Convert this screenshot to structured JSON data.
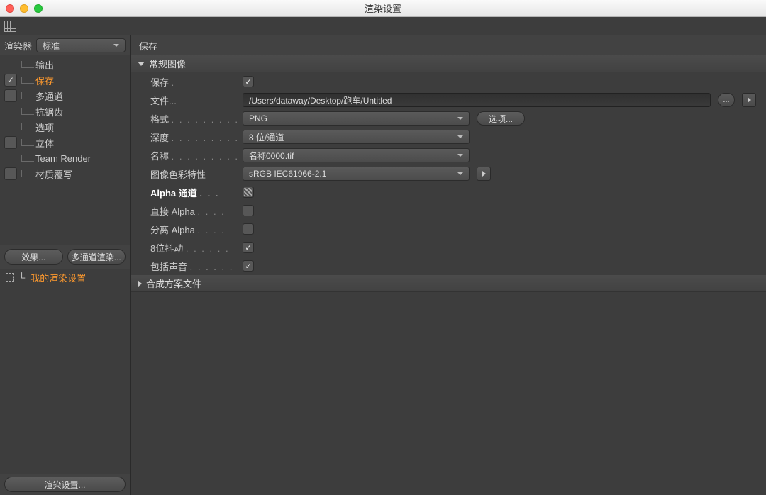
{
  "window": {
    "title": "渲染设置"
  },
  "renderer": {
    "label": "渲染器",
    "value": "标准"
  },
  "sidebar": {
    "items": [
      {
        "label": "输出",
        "check": "none"
      },
      {
        "label": "保存",
        "check": "on",
        "active": true
      },
      {
        "label": "多通道",
        "check": "off"
      },
      {
        "label": "抗锯齿",
        "check": "none"
      },
      {
        "label": "选项",
        "check": "none"
      },
      {
        "label": "立体",
        "check": "off"
      },
      {
        "label": "Team Render",
        "check": "none"
      },
      {
        "label": "材质覆写",
        "check": "off"
      }
    ],
    "effect_btn": "效果...",
    "multipass_btn": "多通道渲染...",
    "my_settings": "我的渲染设置"
  },
  "footer": {
    "button": "渲染设置..."
  },
  "content": {
    "title": "保存",
    "section_regular": "常规图像",
    "section_composite": "合成方案文件",
    "rows": {
      "save": {
        "label": "保存",
        "dots": "."
      },
      "file": {
        "label": "文件...",
        "value": "/Users/dataway/Desktop/跑车/Untitled",
        "browse": "..."
      },
      "format": {
        "label": "格式",
        "dots": ". . . . . . . . .",
        "value": "PNG",
        "options_btn": "选项..."
      },
      "depth": {
        "label": "深度",
        "dots": ". . . . . . . . .",
        "value": "8 位/通道"
      },
      "name": {
        "label": "名称",
        "dots": ". . . . . . . . .",
        "value": "名称0000.tif"
      },
      "colorprofile": {
        "label": "图像色彩特性",
        "value": "sRGB IEC61966-2.1"
      },
      "alpha": {
        "label": "Alpha 通道",
        "dots": ". . ."
      },
      "straight": {
        "label": "直接 Alpha",
        "dots": ". . . ."
      },
      "separate": {
        "label": "分离 Alpha",
        "dots": ". . . ."
      },
      "dither": {
        "label": "8位抖动",
        "dots": ". . . . . ."
      },
      "sound": {
        "label": "包括声音",
        "dots": ". . . . . ."
      }
    }
  }
}
